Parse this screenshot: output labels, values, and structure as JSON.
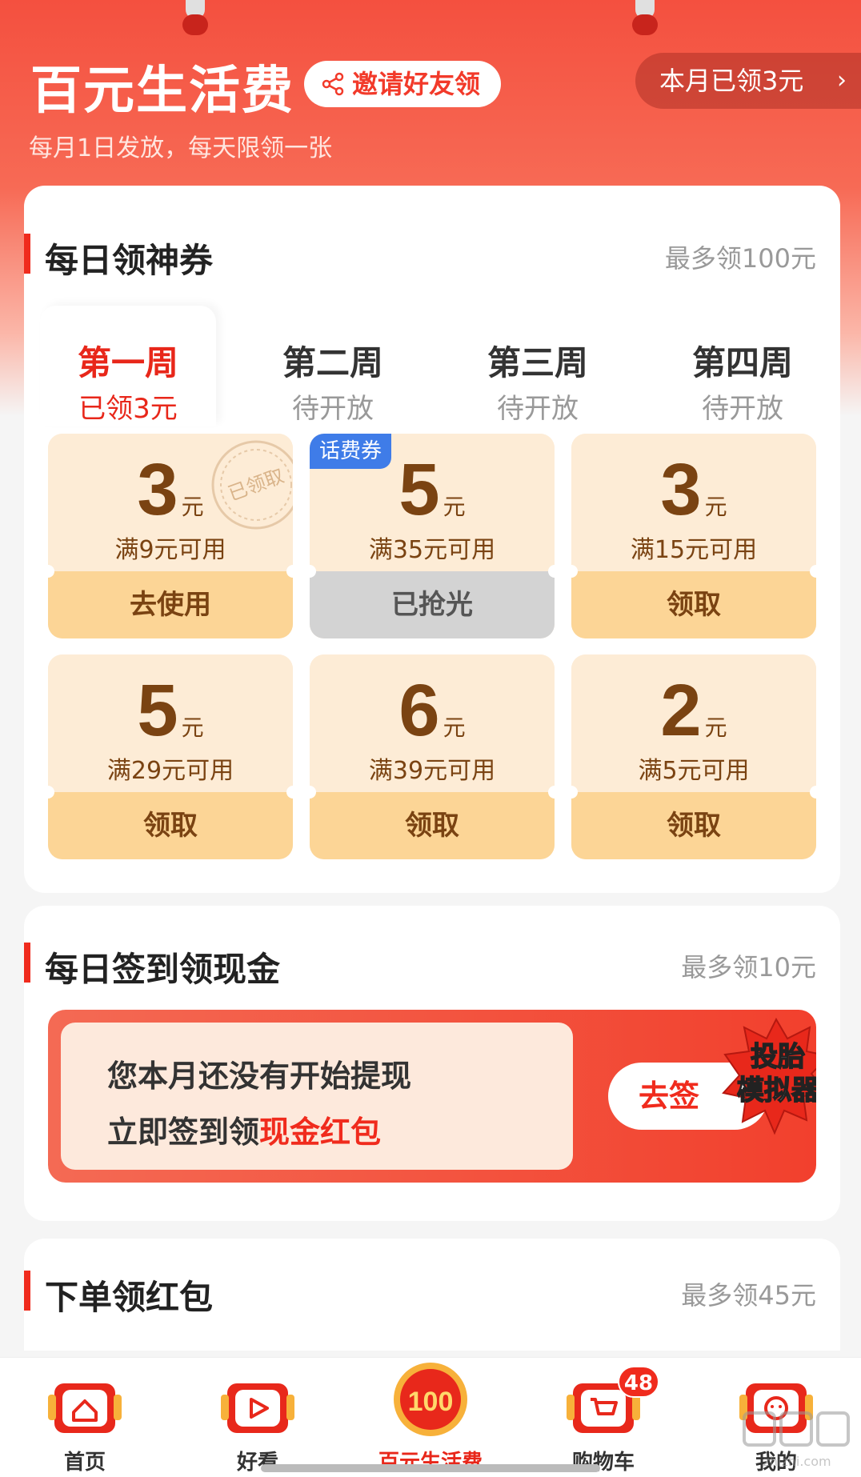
{
  "header": {
    "title": "百元生活费",
    "invite_label": "邀请好友领",
    "subtitle": "每月1日发放，每天限领一张",
    "month_pill": "本月已领3元"
  },
  "daily_coupons": {
    "title": "每日领神券",
    "max_label": "最多领100元",
    "weeks": [
      {
        "name": "第一周",
        "status": "已领3元"
      },
      {
        "name": "第二周",
        "status": "待开放"
      },
      {
        "name": "第三周",
        "status": "待开放"
      },
      {
        "name": "第四周",
        "status": "待开放"
      }
    ],
    "coupons": [
      {
        "value": "3",
        "unit": "元",
        "condition": "满9元可用",
        "button": "去使用",
        "stamp": "已领取"
      },
      {
        "value": "5",
        "unit": "元",
        "condition": "满35元可用",
        "button": "已抢光",
        "tag": "话费券"
      },
      {
        "value": "3",
        "unit": "元",
        "condition": "满15元可用",
        "button": "领取"
      },
      {
        "value": "5",
        "unit": "元",
        "condition": "满29元可用",
        "button": "领取"
      },
      {
        "value": "6",
        "unit": "元",
        "condition": "满39元可用",
        "button": "领取"
      },
      {
        "value": "2",
        "unit": "元",
        "condition": "满5元可用",
        "button": "领取"
      }
    ]
  },
  "checkin": {
    "title": "每日签到领现金",
    "max_label": "最多领10元",
    "line1": "您本月还没有开始提现",
    "line2_prefix": "立即签到领",
    "line2_highlight": "现金红包",
    "button": "去签",
    "burst_line1": "投胎",
    "burst_line2": "模拟器"
  },
  "order_section": {
    "title": "下单领红包",
    "max_label": "最多领45元"
  },
  "tabbar": {
    "items": [
      {
        "label": "首页",
        "icon": "home-icon"
      },
      {
        "label": "好看",
        "icon": "play-icon"
      },
      {
        "label": "百元生活费",
        "icon": "100-badge-icon",
        "badge_text": "100"
      },
      {
        "label": "购物车",
        "icon": "cart-icon",
        "badge": "48"
      },
      {
        "label": "我的",
        "icon": "profile-icon"
      }
    ]
  },
  "watermark": "什么值得买 zhizhi.com",
  "colors": {
    "brand_red": "#f02b1d",
    "coupon_bg": "#fdecd6",
    "coupon_button": "#fcd596",
    "coupon_text": "#7a4312",
    "tag_blue": "#3f7ce8"
  }
}
